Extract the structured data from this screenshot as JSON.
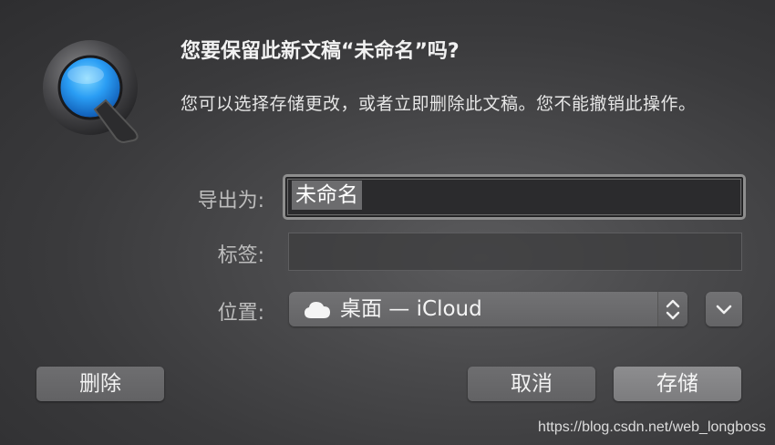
{
  "dialog": {
    "title": "您要保留此新文稿“未命名”吗?",
    "message": "您可以选择存储更改，或者立即删除此文稿。您不能撤销此操作。"
  },
  "form": {
    "export_label": "导出为:",
    "export_value": "未命名",
    "tags_label": "标签:",
    "tags_value": "",
    "location_label": "位置:",
    "location_value": "桌面 — iCloud"
  },
  "buttons": {
    "delete_label": "删除",
    "cancel_label": "取消",
    "save_label": "存储"
  },
  "icons": {
    "app": "quicktime-icon",
    "location": "cloud-icon",
    "stepper": "up-down-chevron-icon",
    "expand": "chevron-down-icon"
  },
  "watermark": "https://blog.csdn.net/web_longboss"
}
